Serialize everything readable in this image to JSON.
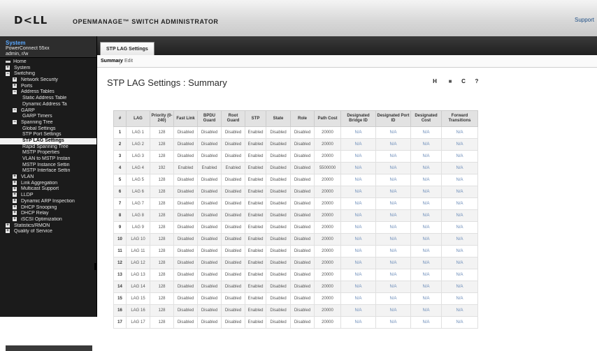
{
  "header": {
    "logo": "D<LL",
    "app_title": "OPENMANAGE™ SWITCH ADMINISTRATOR",
    "support": "Support"
  },
  "system": {
    "title": "System",
    "model": "PowerConnect 55xx",
    "user": "admin, r/w"
  },
  "tree": [
    {
      "label": "Home",
      "level": 0,
      "icon": "home-icon"
    },
    {
      "label": "System",
      "level": 1,
      "icon": "expand-icon"
    },
    {
      "label": "Switching",
      "level": 1,
      "icon": "collapse-icon"
    },
    {
      "label": "Network Security",
      "level": 2,
      "icon": "expand-icon"
    },
    {
      "label": "Ports",
      "level": 2,
      "icon": "expand-icon"
    },
    {
      "label": "Address Tables",
      "level": 2,
      "icon": "collapse-icon"
    },
    {
      "label": "Static Address Table",
      "level": 3
    },
    {
      "label": "Dynamic Address Ta",
      "level": 3
    },
    {
      "label": "GARP",
      "level": 2,
      "icon": "collapse-icon"
    },
    {
      "label": "GARP Timers",
      "level": 3
    },
    {
      "label": "Spanning Tree",
      "level": 2,
      "icon": "collapse-icon"
    },
    {
      "label": "Global Settings",
      "level": 3
    },
    {
      "label": "STP Port Settings",
      "level": 3
    },
    {
      "label": "STP LAG Settings",
      "level": 3,
      "selected": true
    },
    {
      "label": "Rapid Spanning Tree",
      "level": 3
    },
    {
      "label": "MSTP Properties",
      "level": 3
    },
    {
      "label": "VLAN to MSTP Instan",
      "level": 3
    },
    {
      "label": "MSTP Instance Settin",
      "level": 3
    },
    {
      "label": "MSTP Interface Settin",
      "level": 3
    },
    {
      "label": "VLAN",
      "level": 2,
      "icon": "expand-icon"
    },
    {
      "label": "Link Aggregation",
      "level": 2,
      "icon": "expand-icon"
    },
    {
      "label": "Multicast Support",
      "level": 2,
      "icon": "expand-icon"
    },
    {
      "label": "LLDP",
      "level": 2,
      "icon": "expand-icon"
    },
    {
      "label": "Dynamic ARP Inspection",
      "level": 2,
      "icon": "expand-icon"
    },
    {
      "label": "DHCP Snooping",
      "level": 2,
      "icon": "expand-icon"
    },
    {
      "label": "DHCP Relay",
      "level": 2,
      "icon": "expand-icon"
    },
    {
      "label": "iSCSI Optimization",
      "level": 2,
      "icon": "expand-icon"
    },
    {
      "label": "Statistics/RMON",
      "level": 1,
      "icon": "expand-icon"
    },
    {
      "label": "Quality of Service",
      "level": 1,
      "icon": "expand-icon"
    }
  ],
  "tab": {
    "label": "STP LAG Settings"
  },
  "subnav": {
    "summary": "Summary",
    "edit": "Edit"
  },
  "page_title": "STP LAG Settings : Summary",
  "tools": [
    {
      "icon": "save-icon",
      "glyph": "H",
      "color": "#222222"
    },
    {
      "icon": "print-icon",
      "glyph": "■",
      "color": "#555555"
    },
    {
      "icon": "refresh-icon",
      "glyph": "C",
      "color": "#222222"
    },
    {
      "icon": "help-icon",
      "glyph": "?",
      "color": "#222222"
    }
  ],
  "table": {
    "columns": [
      "#",
      "LAG",
      "Priority (0-240)",
      "Fast Link",
      "BPDU Guard",
      "Root Guard",
      "STP",
      "State",
      "Role",
      "Path Cost",
      "Designated Bridge ID",
      "Designated Port ID",
      "Designated Cost",
      "Forward Transitions"
    ],
    "rows": [
      [
        "1",
        "LAG 1",
        "128",
        "Disabled",
        "Disabled",
        "Disabled",
        "Enabled",
        "Disabled",
        "Disabled",
        "20000",
        "N/A",
        "N/A",
        "N/A",
        "N/A"
      ],
      [
        "2",
        "LAG 2",
        "128",
        "Disabled",
        "Disabled",
        "Disabled",
        "Enabled",
        "Disabled",
        "Disabled",
        "20000",
        "N/A",
        "N/A",
        "N/A",
        "N/A"
      ],
      [
        "3",
        "LAG 3",
        "128",
        "Disabled",
        "Disabled",
        "Disabled",
        "Enabled",
        "Disabled",
        "Disabled",
        "20000",
        "N/A",
        "N/A",
        "N/A",
        "N/A"
      ],
      [
        "4",
        "LAG 4",
        "192",
        "Enabled",
        "Enabled",
        "Enabled",
        "Enabled",
        "Disabled",
        "Disabled",
        "5500000",
        "N/A",
        "N/A",
        "N/A",
        "N/A"
      ],
      [
        "5",
        "LAG 5",
        "128",
        "Disabled",
        "Disabled",
        "Disabled",
        "Enabled",
        "Disabled",
        "Disabled",
        "20000",
        "N/A",
        "N/A",
        "N/A",
        "N/A"
      ],
      [
        "6",
        "LAG 6",
        "128",
        "Disabled",
        "Disabled",
        "Disabled",
        "Enabled",
        "Disabled",
        "Disabled",
        "20000",
        "N/A",
        "N/A",
        "N/A",
        "N/A"
      ],
      [
        "7",
        "LAG 7",
        "128",
        "Disabled",
        "Disabled",
        "Disabled",
        "Enabled",
        "Disabled",
        "Disabled",
        "20000",
        "N/A",
        "N/A",
        "N/A",
        "N/A"
      ],
      [
        "8",
        "LAG 8",
        "128",
        "Disabled",
        "Disabled",
        "Disabled",
        "Enabled",
        "Disabled",
        "Disabled",
        "20000",
        "N/A",
        "N/A",
        "N/A",
        "N/A"
      ],
      [
        "9",
        "LAG 9",
        "128",
        "Disabled",
        "Disabled",
        "Disabled",
        "Enabled",
        "Disabled",
        "Disabled",
        "20000",
        "N/A",
        "N/A",
        "N/A",
        "N/A"
      ],
      [
        "10",
        "LAG 10",
        "128",
        "Disabled",
        "Disabled",
        "Disabled",
        "Enabled",
        "Disabled",
        "Disabled",
        "20000",
        "N/A",
        "N/A",
        "N/A",
        "N/A"
      ],
      [
        "11",
        "LAG 11",
        "128",
        "Disabled",
        "Disabled",
        "Disabled",
        "Enabled",
        "Disabled",
        "Disabled",
        "20000",
        "N/A",
        "N/A",
        "N/A",
        "N/A"
      ],
      [
        "12",
        "LAG 12",
        "128",
        "Disabled",
        "Disabled",
        "Disabled",
        "Enabled",
        "Disabled",
        "Disabled",
        "20000",
        "N/A",
        "N/A",
        "N/A",
        "N/A"
      ],
      [
        "13",
        "LAG 13",
        "128",
        "Disabled",
        "Disabled",
        "Disabled",
        "Enabled",
        "Disabled",
        "Disabled",
        "20000",
        "N/A",
        "N/A",
        "N/A",
        "N/A"
      ],
      [
        "14",
        "LAG 14",
        "128",
        "Disabled",
        "Disabled",
        "Disabled",
        "Enabled",
        "Disabled",
        "Disabled",
        "20000",
        "N/A",
        "N/A",
        "N/A",
        "N/A"
      ],
      [
        "15",
        "LAG 15",
        "128",
        "Disabled",
        "Disabled",
        "Disabled",
        "Enabled",
        "Disabled",
        "Disabled",
        "20000",
        "N/A",
        "N/A",
        "N/A",
        "N/A"
      ],
      [
        "16",
        "LAG 16",
        "128",
        "Disabled",
        "Disabled",
        "Disabled",
        "Enabled",
        "Disabled",
        "Disabled",
        "20000",
        "N/A",
        "N/A",
        "N/A",
        "N/A"
      ],
      [
        "17",
        "LAG 17",
        "128",
        "Disabled",
        "Disabled",
        "Disabled",
        "Enabled",
        "Disabled",
        "Disabled",
        "20000",
        "N/A",
        "N/A",
        "N/A",
        "N/A"
      ]
    ]
  }
}
